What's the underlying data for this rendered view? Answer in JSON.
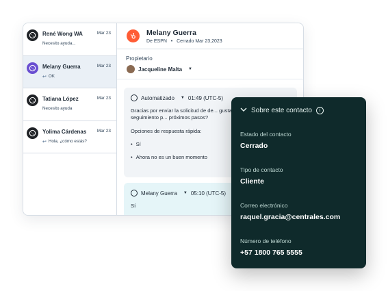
{
  "conversations": [
    {
      "name": "René Wong WA",
      "date": "Mar 23",
      "preview": "Necesito ayuda...",
      "reply": false
    },
    {
      "name": "Melany Guerra",
      "date": "Mar 23",
      "preview": "OK",
      "reply": true
    },
    {
      "name": "Tatiana López",
      "date": "Mar 23",
      "preview": "Necesito ayuda",
      "reply": false
    },
    {
      "name": "Yolima Cárdenas",
      "date": "Mar 23",
      "preview": "Hola, ¿cómo estás?",
      "reply": true
    }
  ],
  "header": {
    "title": "Melany Guerra",
    "source": "De ESPN",
    "status": "Cerrado Mar 23,2023"
  },
  "owner": {
    "label": "Propietario",
    "name": "Jacqueline Malta"
  },
  "message1": {
    "sender": "Automatizado",
    "time": "01:49 (UTC-5)",
    "text": "Gracias por enviar la solicitud de de... gustaria programar un seguimiento p... próximos pasos?",
    "options_label": "Opciones de respuesta rápida:",
    "options": [
      "Sí",
      "Ahora no es un buen momento"
    ]
  },
  "message2": {
    "sender": "Melany Guerra",
    "time": "05:10 (UTC-5)",
    "text": "Sí"
  },
  "panel": {
    "title": "Sobre este contacto",
    "fields": [
      {
        "label": "Estado del contacto",
        "value": "Cerrado"
      },
      {
        "label": "Tipo de contacto",
        "value": "Cliente"
      },
      {
        "label": "Correo electrónico",
        "value": "raquel.gracia@centrales.com"
      },
      {
        "label": "Número de teléfono",
        "value": "+57 1800 765 5555"
      }
    ]
  },
  "colors": {
    "hubspot_orange": "#ff5c35",
    "panel_bg": "#0f2a2b",
    "active_row": "#eaf0f6"
  },
  "icons": {
    "whatsapp": "whatsapp-icon",
    "reply": "reply-arrow-icon",
    "info": "info-icon",
    "chevron": "chevron-down-icon"
  }
}
